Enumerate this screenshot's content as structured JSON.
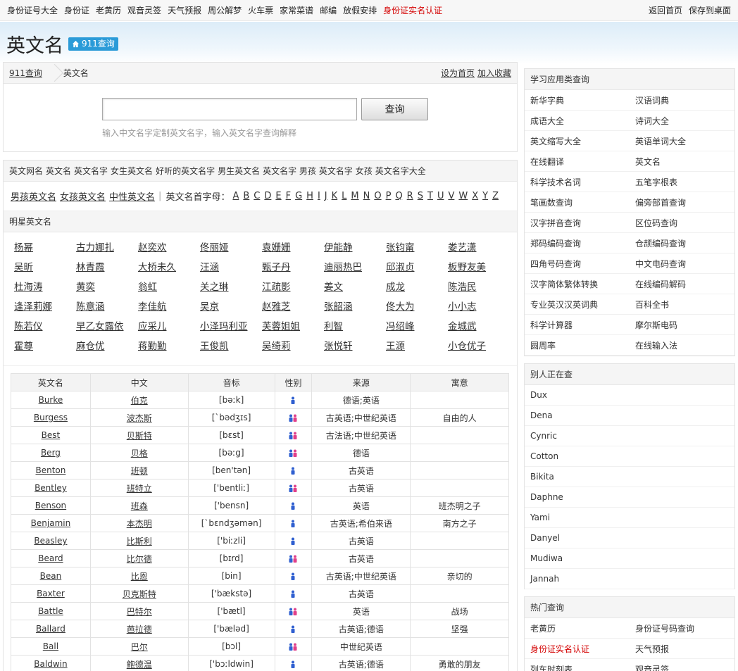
{
  "topbar": {
    "nav": [
      "身份证号大全",
      "身份证",
      "老黄历",
      "观音灵签",
      "天气预报",
      "周公解梦",
      "火车票",
      "家常菜谱",
      "邮编",
      "放假安排"
    ],
    "nav_red": "身份证实名认证",
    "right": [
      "返回首页",
      "保存到桌面"
    ]
  },
  "hero": {
    "title": "英文名",
    "badge": "911查询"
  },
  "breadcrumb": {
    "home": "911查询",
    "current": "英文名",
    "set_home": "设为首页",
    "add_fav": "加入收藏"
  },
  "search": {
    "button": "查询",
    "hint": "输入中文名字定制英文名字，输入英文名字查询解释",
    "value": ""
  },
  "tags": [
    "英文网名",
    "英文名",
    "英文名字",
    "女生英文名",
    "好听的英文名字",
    "男生英文名",
    "英文名字 男孩",
    "英文名字 女孩",
    "英文名字大全"
  ],
  "letters": {
    "links": [
      "男孩英文名",
      "女孩英文名",
      "中性英文名"
    ],
    "label": "英文名首字母：",
    "items": [
      "A",
      "B",
      "C",
      "D",
      "E",
      "F",
      "G",
      "H",
      "I",
      "J",
      "K",
      "L",
      "M",
      "N",
      "O",
      "P",
      "Q",
      "R",
      "S",
      "T",
      "U",
      "V",
      "W",
      "X",
      "Y",
      "Z"
    ]
  },
  "stars": {
    "title": "明星英文名",
    "items": [
      "杨幂",
      "古力娜扎",
      "赵奕欢",
      "佟丽娅",
      "袁姗姗",
      "伊能静",
      "张钧甯",
      "娄艺潇",
      "吴昕",
      "林青霞",
      "大桥未久",
      "汪涵",
      "甄子丹",
      "迪丽热巴",
      "邱淑贞",
      "板野友美",
      "杜海涛",
      "黄奕",
      "翁虹",
      "关之琳",
      "江疏影",
      "姜文",
      "成龙",
      "陈浩民",
      "逢泽莉娜",
      "陈意涵",
      "李佳航",
      "吴京",
      "赵雅芝",
      "张韶涵",
      "佟大为",
      "小小志",
      "陈若仪",
      "早乙女露依",
      "应采儿",
      "小泽玛利亚",
      "芙蓉姐姐",
      "利智",
      "冯绍峰",
      "金城武",
      "霍尊",
      "麻仓优",
      "蒋勤勤",
      "王俊凯",
      "吴绮莉",
      "张悦轩",
      "王源",
      "小仓优子"
    ]
  },
  "table": {
    "headers": [
      "英文名",
      "中文",
      "音标",
      "性别",
      "来源",
      "寓意"
    ],
    "rows": [
      {
        "en": "Burke",
        "cn": "伯克",
        "ipa": "[bəːk]",
        "g": "m",
        "src": "德语;英语",
        "mean": ""
      },
      {
        "en": "Burgess",
        "cn": "波杰斯",
        "ipa": "[ˋbədʒɪs]",
        "g": "u",
        "src": "古英语;中世纪英语",
        "mean": "自由的人"
      },
      {
        "en": "Best",
        "cn": "贝斯特",
        "ipa": "[bɛst]",
        "g": "u",
        "src": "古法语;中世纪英语",
        "mean": ""
      },
      {
        "en": "Berg",
        "cn": "贝格",
        "ipa": "[bəːg]",
        "g": "u",
        "src": "德语",
        "mean": ""
      },
      {
        "en": "Benton",
        "cn": "班顿",
        "ipa": "[ben'tən]",
        "g": "m",
        "src": "古英语",
        "mean": ""
      },
      {
        "en": "Bentley",
        "cn": "班特立",
        "ipa": "['bentliː]",
        "g": "u",
        "src": "古英语",
        "mean": ""
      },
      {
        "en": "Benson",
        "cn": "班森",
        "ipa": "['bensn]",
        "g": "m",
        "src": "英语",
        "mean": "班杰明之子"
      },
      {
        "en": "Benjamin",
        "cn": "本杰明",
        "ipa": "[ˋbɛndʒəmən]",
        "g": "m",
        "src": "古英语;希伯来语",
        "mean": "南方之子"
      },
      {
        "en": "Beasley",
        "cn": "比斯利",
        "ipa": "['biːzli]",
        "g": "m",
        "src": "古英语",
        "mean": ""
      },
      {
        "en": "Beard",
        "cn": "比尔德",
        "ipa": "[bɪrd]",
        "g": "u",
        "src": "古英语",
        "mean": ""
      },
      {
        "en": "Bean",
        "cn": "比恩",
        "ipa": "[bin]",
        "g": "m",
        "src": "古英语;中世纪英语",
        "mean": "亲切的"
      },
      {
        "en": "Baxter",
        "cn": "贝克斯特",
        "ipa": "['bækstə]",
        "g": "m",
        "src": "古英语",
        "mean": ""
      },
      {
        "en": "Battle",
        "cn": "巴特尔",
        "ipa": "['bætl]",
        "g": "u",
        "src": "英语",
        "mean": "战场"
      },
      {
        "en": "Ballard",
        "cn": "芭拉德",
        "ipa": "['bæləd]",
        "g": "m",
        "src": "古英语;德语",
        "mean": "坚强"
      },
      {
        "en": "Ball",
        "cn": "巴尔",
        "ipa": "[bɔl]",
        "g": "u",
        "src": "中世纪英语",
        "mean": ""
      },
      {
        "en": "Baldwin",
        "cn": "鲍德温",
        "ipa": "['bɔːldwin]",
        "g": "m",
        "src": "古英语;德语",
        "mean": "勇敢的朋友"
      }
    ]
  },
  "side1": {
    "title": "学习应用类查询",
    "items": [
      "新华字典",
      "汉语词典",
      "成语大全",
      "诗词大全",
      "英文缩写大全",
      "英语单词大全",
      "在线翻译",
      "英文名",
      "科学技术名词",
      "五笔字根表",
      "笔画数查询",
      "偏旁部首查询",
      "汉字拼音查询",
      "区位码查询",
      "郑码编码查询",
      "仓颉编码查询",
      "四角号码查询",
      "中文电码查询",
      "汉字简体繁体转换",
      "在线编码解码",
      "专业英汉汉英词典",
      "百科全书",
      "科学计算器",
      "摩尔斯电码",
      "圆周率",
      "在线输入法"
    ]
  },
  "side2": {
    "title": "别人正在查",
    "items": [
      "Dux",
      "Dena",
      "Cynric",
      "Cotton",
      "Bikita",
      "Daphne",
      "Yami",
      "Danyel",
      "Mudiwa",
      "Jannah"
    ]
  },
  "side3": {
    "title": "热门查询",
    "items": [
      "老黄历",
      "身份证号码查询",
      "身份证实名认证",
      "天气预报",
      "列车时刻表",
      "观音灵签"
    ]
  },
  "colors": {
    "accent": "#2b9bd8",
    "red": "#d40000",
    "male": "#2f5fd0",
    "female": "#e0408a"
  }
}
